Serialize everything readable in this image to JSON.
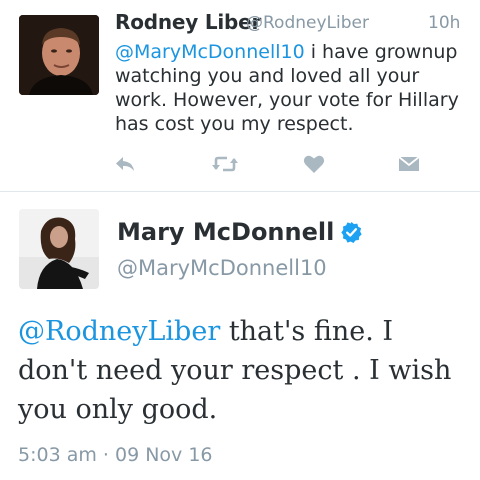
{
  "tweet": {
    "author_name": "Rodney Liber",
    "handle": "@RodneyLiber",
    "time": "10h",
    "mention": "@MaryMcDonnell10",
    "text": " i have grownup watching you and loved all your work. However, your vote for Hillary has cost you my respect.",
    "actions": [
      "reply-icon",
      "retweet-icon",
      "like-icon",
      "direct-message-icon"
    ]
  },
  "reply": {
    "author_name": "Mary McDonnell",
    "handle": "@MaryMcDonnell10",
    "verified": true,
    "mention": "@RodneyLiber",
    "text": " that's fine. I don't need your respect . I wish you only good.",
    "timestamp": "5:03 am · 09 Nov 16"
  },
  "colors": {
    "link": "#1b95e0",
    "muted": "#8899a6",
    "icon": "#aab8c2",
    "text": "#292f33",
    "verified": "#1da1f2"
  }
}
